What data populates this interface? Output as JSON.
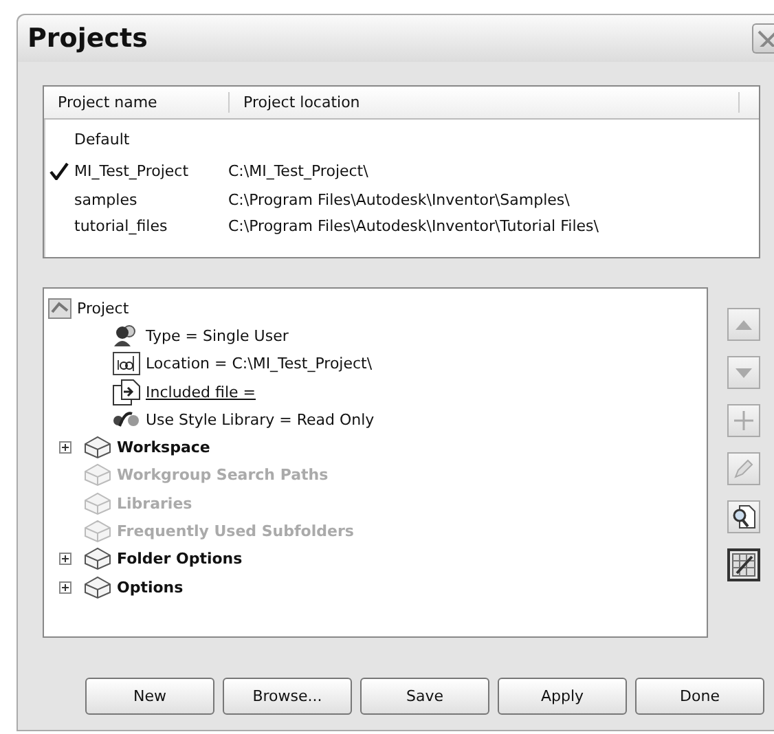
{
  "window": {
    "title": "Projects"
  },
  "projects": {
    "columns": [
      "Project name",
      "Project location"
    ],
    "rows": [
      {
        "name": "Default",
        "location": "",
        "active": false
      },
      {
        "name": "MI_Test_Project",
        "location": "C:\\MI_Test_Project\\",
        "active": true
      },
      {
        "name": "samples",
        "location": "C:\\Program Files\\Autodesk\\Inventor\\Samples\\",
        "active": false
      },
      {
        "name": "tutorial_files",
        "location": "C:\\Program Files\\Autodesk\\Inventor\\Tutorial Files\\",
        "active": false
      }
    ]
  },
  "tree": {
    "label": "Project",
    "kind": "root",
    "children": [
      {
        "label": "Type = Single User",
        "kind": "user"
      },
      {
        "label": "Location = C:\\MI_Test_Project\\",
        "kind": "text"
      },
      {
        "label": "Included file =",
        "kind": "file"
      },
      {
        "label": "Use Style Library = Read Only",
        "kind": "style"
      },
      {
        "label": "Workspace",
        "kind": "folder",
        "expandable": true,
        "disabled": false
      },
      {
        "label": "Workgroup Search Paths",
        "kind": "folder",
        "expandable": false,
        "disabled": true
      },
      {
        "label": "Libraries",
        "kind": "folder",
        "expandable": false,
        "disabled": true
      },
      {
        "label": "Frequently Used Subfolders",
        "kind": "folder",
        "expandable": false,
        "disabled": true
      },
      {
        "label": "Folder Options",
        "kind": "folder",
        "expandable": true,
        "disabled": false
      },
      {
        "label": "Options",
        "kind": "folder",
        "expandable": true,
        "disabled": false
      }
    ]
  },
  "side_buttons": [
    {
      "kind": "up",
      "disabled": true,
      "pressed": false
    },
    {
      "kind": "down",
      "disabled": true,
      "pressed": false
    },
    {
      "kind": "add",
      "disabled": true,
      "pressed": false
    },
    {
      "kind": "edit",
      "disabled": true,
      "pressed": false
    },
    {
      "kind": "find",
      "disabled": false,
      "pressed": false
    },
    {
      "kind": "grid",
      "disabled": false,
      "pressed": true
    }
  ],
  "buttons": [
    "New",
    "Browse...",
    "Save",
    "Apply",
    "Done"
  ]
}
